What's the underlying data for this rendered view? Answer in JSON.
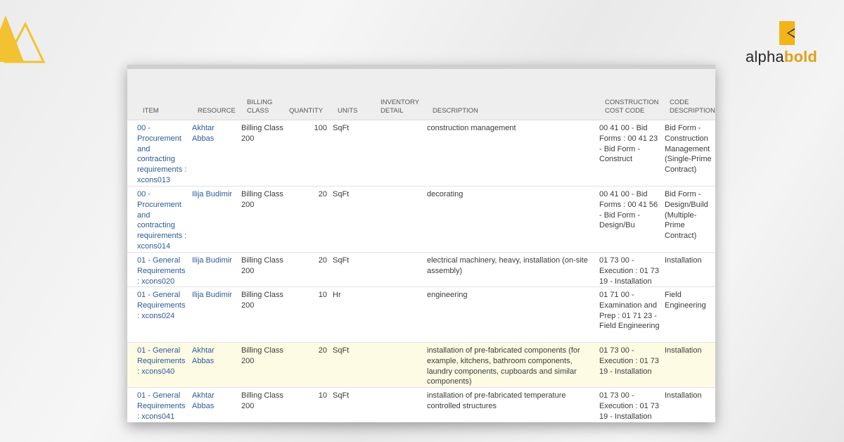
{
  "brand": {
    "name_light": "alpha",
    "name_bold": "bold",
    "colors": {
      "accent": "#e0a11b",
      "text": "#2a2a2a"
    }
  },
  "table": {
    "headers": {
      "item": "ITEM",
      "resource": "RESOURCE",
      "billing_class": "BILLING CLASS",
      "quantity": "QUANTITY",
      "units": "UNITS",
      "inventory_detail": "INVENTORY DETAIL",
      "description": "DESCRIPTION",
      "construction_cost_code": "CONSTRUCTION COST CODE",
      "code_description": "CODE DESCRIPTION"
    },
    "rows": [
      {
        "item": "00 - Procurement and contracting requirements : xcons013",
        "resource": "Akhtar Abbas",
        "billing_class": "Billing Class 200",
        "quantity": "100",
        "units": "SqFt",
        "inventory_detail": "",
        "description": "construction management",
        "construction_cost_code": "00 41 00 - Bid Forms : 00 41 23 - Bid Form - Construct",
        "code_description": "Bid Form - Construction Management (Single-Prime Contract)"
      },
      {
        "item": "00 - Procurement and contracting requirements : xcons014",
        "resource": "Ilija Budimir",
        "billing_class": "Billing Class 200",
        "quantity": "20",
        "units": "SqFt",
        "inventory_detail": "",
        "description": "decorating",
        "construction_cost_code": "00 41 00 - Bid Forms : 00 41 56 - Bid Form - Design/Bu",
        "code_description": "Bid Form - Design/Build (Multiple-Prime Contract)"
      },
      {
        "item": "01 - General Requirements : xcons020",
        "resource": "Ilija Budimir",
        "billing_class": "Billing Class 200",
        "quantity": "20",
        "units": "SqFt",
        "inventory_detail": "",
        "description": "electrical machinery, heavy, installation (on-site assembly)",
        "construction_cost_code": "01 73 00 - Execution : 01 73 19 - Installation",
        "code_description": "Installation"
      },
      {
        "item": "01 - General Requirements : xcons024",
        "resource": "Ilija Budimir",
        "billing_class": "Billing Class 200",
        "quantity": "10",
        "units": "Hr",
        "inventory_detail": "",
        "description": "engineering",
        "construction_cost_code": "01 71 00 - Examination and Prep : 01 71 23 - Field Engineering",
        "code_description": "Field Engineering"
      },
      {
        "item": "01 - General Requirements : xcons040",
        "resource": "Akhtar Abbas",
        "billing_class": "Billing Class 200",
        "quantity": "20",
        "units": "SqFt",
        "inventory_detail": "",
        "description": "installation of pre-fabricated components (for example, kitchens, bathroom components, laundry components, cupboards and similar components)",
        "construction_cost_code": "01 73 00 - Execution : 01 73 19 - Installation",
        "code_description": "Installation"
      },
      {
        "item": "01 - General Requirements : xcons041",
        "resource": "Akhtar Abbas",
        "billing_class": "Billing Class 200",
        "quantity": "10",
        "units": "SqFt",
        "inventory_detail": "",
        "description": "installation of pre-fabricated temperature controlled structures",
        "construction_cost_code": "01 73 00 - Execution : 01 73 19 - Installation",
        "code_description": "Installation"
      }
    ]
  }
}
